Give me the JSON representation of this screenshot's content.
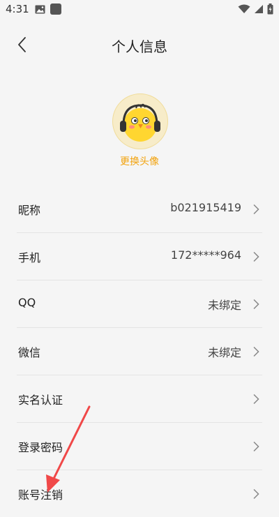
{
  "status_bar": {
    "time": "4:31"
  },
  "header": {
    "title": "个人信息"
  },
  "avatar": {
    "change_label": "更换头像"
  },
  "rows": [
    {
      "label": "昵称",
      "value": "b021915419"
    },
    {
      "label": "手机",
      "value": "172*****964"
    },
    {
      "label": "QQ",
      "value": "未绑定"
    },
    {
      "label": "微信",
      "value": "未绑定"
    },
    {
      "label": "实名认证",
      "value": ""
    },
    {
      "label": "登录密码",
      "value": ""
    },
    {
      "label": "账号注销",
      "value": ""
    }
  ],
  "colors": {
    "accent": "#f2a20c",
    "annotation_arrow": "#f04848"
  }
}
